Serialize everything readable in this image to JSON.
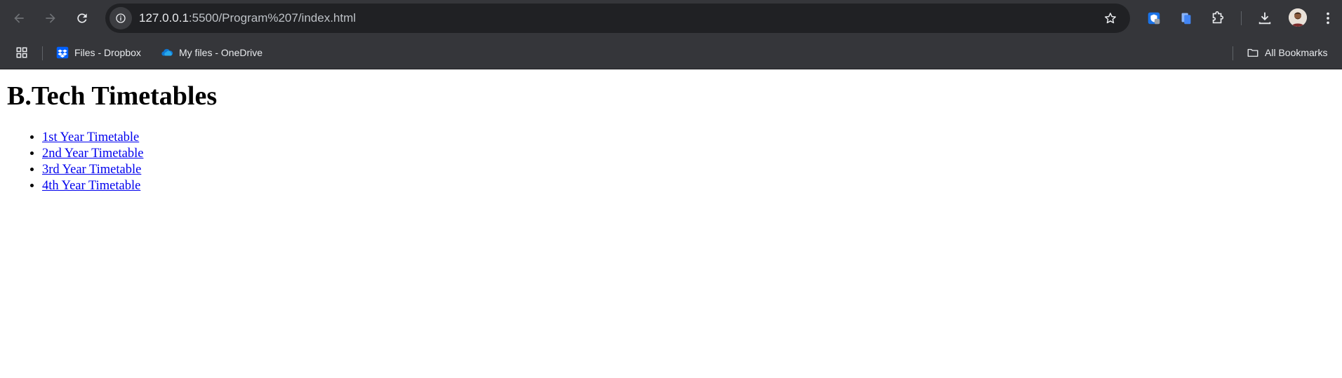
{
  "browser": {
    "url_host": "127.0.0.1",
    "url_path": ":5500/Program%207/index.html",
    "icons": [
      "back-icon",
      "forward-icon",
      "reload-icon",
      "site-info-icon",
      "star-icon",
      "extension-shield-icon",
      "extension-docs-icon",
      "extensions-puzzle-icon",
      "download-icon",
      "avatar",
      "menu-kebab-icon"
    ],
    "colors": {
      "chrome_bg": "#35363a",
      "omnibox_bg": "#202124",
      "link": "#0000ee"
    }
  },
  "bookmarks": {
    "items": [
      {
        "label": "Files - Dropbox",
        "icon": "dropbox-icon"
      },
      {
        "label": "My files - OneDrive",
        "icon": "onedrive-icon"
      }
    ],
    "all_bookmarks_label": "All Bookmarks"
  },
  "page": {
    "title": "B.Tech Timetables",
    "links": [
      {
        "label": "1st Year Timetable"
      },
      {
        "label": "2nd Year Timetable"
      },
      {
        "label": "3rd Year Timetable"
      },
      {
        "label": "4th Year Timetable"
      }
    ]
  }
}
